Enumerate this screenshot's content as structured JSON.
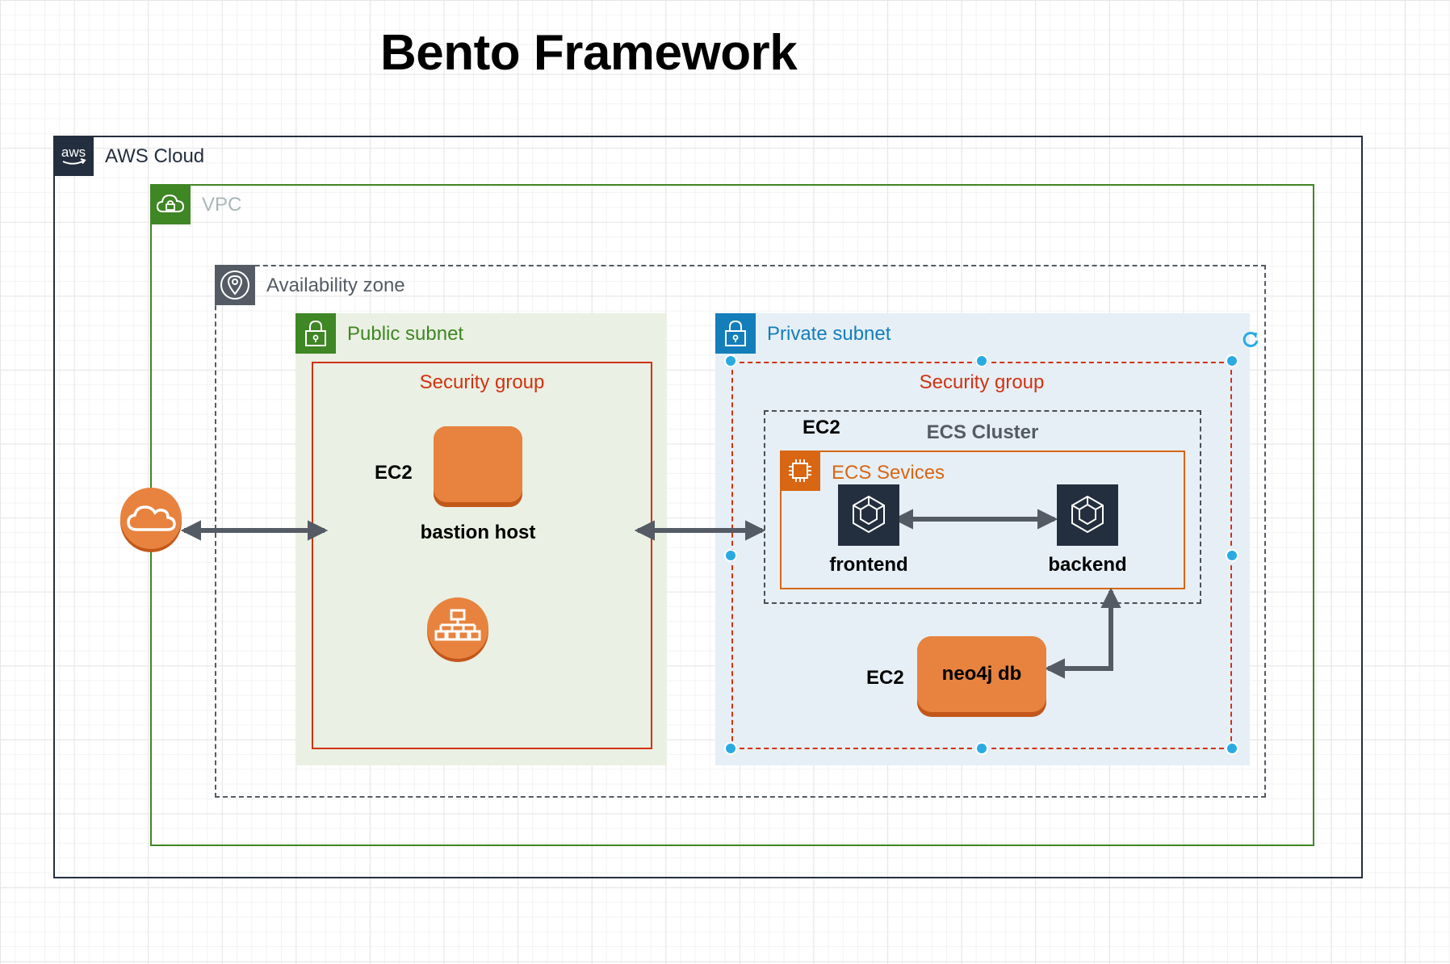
{
  "title": "Bento Framework",
  "groups": {
    "aws_cloud": {
      "label": "AWS Cloud",
      "icon": "aws-logo-icon",
      "color": "#232f3e"
    },
    "vpc": {
      "label": "VPC",
      "icon": "cloud-lock-icon",
      "color": "#3f8624"
    },
    "availability_zone": {
      "label": "Availability zone",
      "icon": "location-pin-icon",
      "color": "#545b64"
    },
    "public_subnet": {
      "label": "Public subnet",
      "icon": "padlock-icon",
      "color": "#3f8624"
    },
    "private_subnet": {
      "label": "Private subnet",
      "icon": "padlock-icon",
      "color": "#147eba"
    },
    "public_security_group": {
      "label": "Security group",
      "color": "#d13212"
    },
    "private_security_group": {
      "label": "Security group",
      "color": "#d13212"
    },
    "ecs_cluster": {
      "label": "ECS Cluster",
      "tag": "EC2"
    },
    "ecs_services": {
      "label": "ECS Sevices",
      "icon": "chip-icon",
      "color": "#d86613"
    }
  },
  "nodes": {
    "internet": {
      "icon": "internet-cloud-icon",
      "color": "#e7833e"
    },
    "bastion": {
      "label": "bastion host",
      "tag": "EC2",
      "color": "#e7833e"
    },
    "load_balancer": {
      "icon": "load-balancer-icon",
      "color": "#e7833e"
    },
    "frontend": {
      "label": "frontend",
      "icon": "ecs-task-icon"
    },
    "backend": {
      "label": "backend",
      "icon": "ecs-task-icon"
    },
    "neo4j": {
      "label": "neo4j db",
      "tag": "EC2",
      "color": "#e7833e"
    }
  },
  "edges": [
    {
      "from": "internet",
      "to": "public_subnet",
      "direction": "both"
    },
    {
      "from": "public_subnet",
      "to": "ecs_cluster",
      "direction": "both"
    },
    {
      "from": "frontend",
      "to": "backend",
      "direction": "both"
    },
    {
      "from": "neo4j",
      "to": "backend",
      "direction": "both"
    }
  ]
}
